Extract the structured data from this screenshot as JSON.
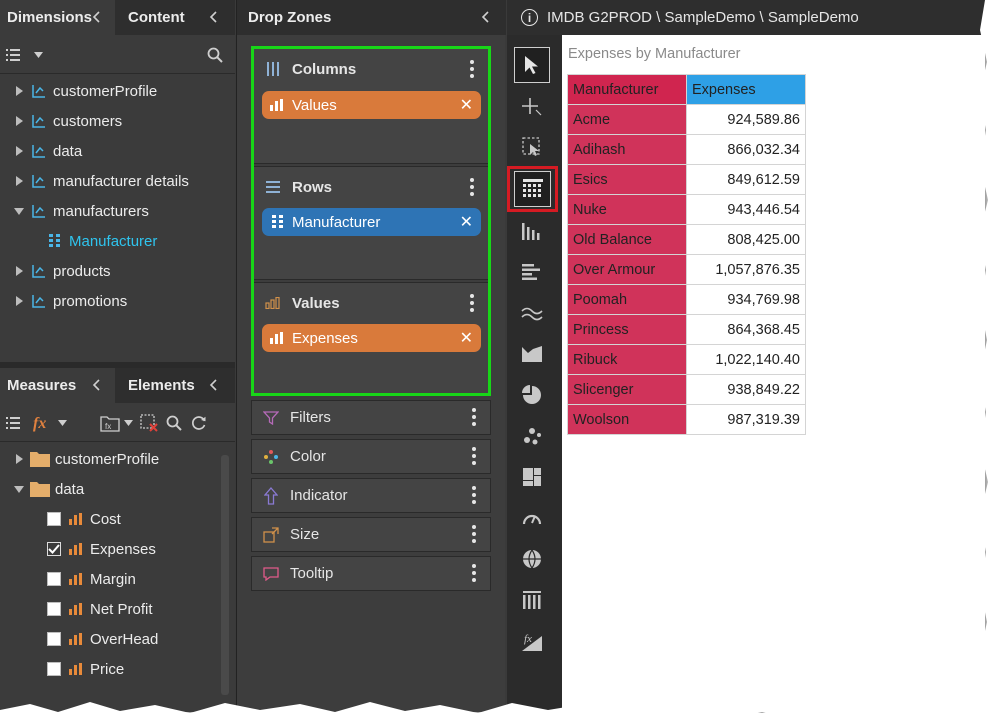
{
  "left": {
    "tabs": [
      "Dimensions",
      "Content"
    ],
    "dimensions": [
      {
        "label": "customerProfile",
        "expanded": false
      },
      {
        "label": "customers",
        "expanded": false
      },
      {
        "label": "data",
        "expanded": false
      },
      {
        "label": "manufacturer details",
        "expanded": false
      },
      {
        "label": "manufacturers",
        "expanded": true
      },
      {
        "label": "Manufacturer",
        "child": true
      },
      {
        "label": "products",
        "expanded": false
      },
      {
        "label": "promotions",
        "expanded": false
      }
    ],
    "bottom_tabs": [
      "Measures",
      "Elements"
    ],
    "measure_folders": [
      "customerProfile",
      "data"
    ],
    "measures": [
      {
        "label": "Cost",
        "checked": false
      },
      {
        "label": "Expenses",
        "checked": true
      },
      {
        "label": "Margin",
        "checked": false
      },
      {
        "label": "Net Profit",
        "checked": false
      },
      {
        "label": "OverHead",
        "checked": false
      },
      {
        "label": "Price",
        "checked": false
      }
    ]
  },
  "dropzones": {
    "title": "Drop Zones",
    "columns": {
      "label": "Columns",
      "pill": "Values"
    },
    "rows": {
      "label": "Rows",
      "pill": "Manufacturer"
    },
    "values": {
      "label": "Values",
      "pill": "Expenses"
    },
    "others": [
      "Filters",
      "Color",
      "Indicator",
      "Size",
      "Tooltip"
    ]
  },
  "topbar": {
    "breadcrumb": "IMDB G2PROD \\ SampleDemo \\ SampleDemo",
    "info_glyph": "i"
  },
  "toolbar_icons": [
    "pointer-icon",
    "crosshair-icon",
    "selection-icon",
    "grid-icon",
    "column-chart-icon",
    "bar-chart-icon",
    "line-chart-icon",
    "area-chart-icon",
    "pie-chart-icon",
    "scatter-icon",
    "treemap-icon",
    "gauge-icon",
    "map-icon",
    "card-icon",
    "formula-icon"
  ],
  "grid": {
    "title": "Expenses by Manufacturer",
    "header": [
      "Manufacturer",
      "Expenses"
    ],
    "rows": [
      [
        "Acme",
        "924,589.86"
      ],
      [
        "Adihash",
        "866,032.34"
      ],
      [
        "Esics",
        "849,612.59"
      ],
      [
        "Nuke",
        "943,446.54"
      ],
      [
        "Old Balance",
        "808,425.00"
      ],
      [
        "Over Armour",
        "1,057,876.35"
      ],
      [
        "Poomah",
        "934,769.98"
      ],
      [
        "Princess",
        "864,368.45"
      ],
      [
        "Ribuck",
        "1,022,140.40"
      ],
      [
        "Slicenger",
        "938,849.22"
      ],
      [
        "Woolson",
        "987,319.39"
      ]
    ]
  },
  "colors": {
    "accent_green": "#18d618",
    "pill_orange": "#d97a3b",
    "pill_blue": "#2e74b5",
    "row_red": "#d0335a",
    "header_blue": "#2ea0e6",
    "highlight": "#d51b23",
    "link_cyan": "#2fc4ee"
  }
}
